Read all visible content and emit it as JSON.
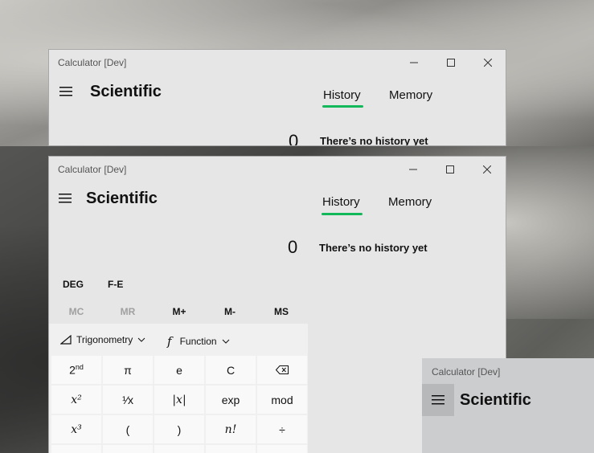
{
  "window1": {
    "title": "Calculator [Dev]",
    "mode": "Scientific",
    "tabs": [
      "History",
      "Memory"
    ],
    "display": "0",
    "history_empty": "There’s no history yet"
  },
  "window2": {
    "title": "Calculator [Dev]",
    "mode": "Scientific",
    "tabs": [
      "History",
      "Memory"
    ],
    "display": "0",
    "history_empty": "There’s no history yet",
    "angle_mode": "DEG",
    "notation": "F-E",
    "memory_buttons": [
      "MC",
      "MR",
      "M+",
      "M-",
      "MS"
    ],
    "dropdowns": {
      "trig_label": "Trigonometry",
      "function_label": "Function",
      "function_icon": "f"
    },
    "keys": {
      "row1": [
        "2nd",
        "π",
        "e",
        "C",
        "backspace"
      ],
      "row2": [
        "x²",
        "¹⁄x",
        "|x|",
        "exp",
        "mod"
      ],
      "row3": [
        "x³",
        "(",
        ")",
        "n!",
        "÷"
      ]
    }
  },
  "window3": {
    "title": "Calculator [Dev]",
    "mode": "Scientific"
  },
  "colors": {
    "accent": "#12b85a",
    "window_bg": "#e6e6e6",
    "keypad_bg": "#f0f0f0",
    "disabled_text": "#a0a0a0"
  }
}
